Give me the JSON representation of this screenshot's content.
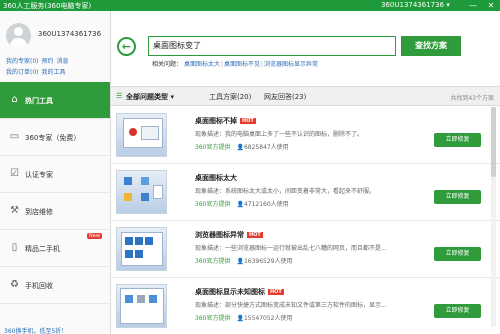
{
  "titlebar": {
    "app_title": "360人工服务(360电脑专家)",
    "user": "360U1374361736 ▾",
    "minimize": "—",
    "close": "✕"
  },
  "profile": {
    "username": "360U1374361736",
    "links_row1": [
      "我的专家(0)",
      "预约",
      "消息"
    ],
    "links_row2": [
      "我的订单(0)",
      "我的工具"
    ]
  },
  "sidebar": {
    "items": [
      {
        "label": "热门工具",
        "icon": "home-icon"
      },
      {
        "label": "360专家（免费）",
        "icon": "chat-icon"
      },
      {
        "label": "认证专家",
        "icon": "check-icon"
      },
      {
        "label": "到店维修",
        "icon": "wrench-icon"
      },
      {
        "label": "精品二手机",
        "icon": "phone-icon",
        "badge": "New"
      },
      {
        "label": "手机回收",
        "icon": "recycle-icon"
      }
    ],
    "promo": "360换手机，低至5折！"
  },
  "search": {
    "value": "桌面图标变了",
    "button": "查找方案",
    "related_label": "相关问题：",
    "related": [
      "桌面图标太大",
      "桌面图标不见",
      "浏览器图标显示异常"
    ]
  },
  "filters": {
    "all_types": "全部问题类型",
    "tools": "工具方案(20)",
    "netizen": "网友回答(23)",
    "count": "共找到43个方案"
  },
  "results": [
    {
      "title": "桌面图标不掉",
      "hot": "HOT",
      "desc": "现象描述：我的电脑桌面上多了一些不认识的图标，删除不了。",
      "provider": "360官方提供",
      "users": "6825847人使用",
      "button": "立即修复"
    },
    {
      "title": "桌面图标太大",
      "hot": "",
      "desc": "现象描述：系统图标太大或太小，间距变着非常大，看起来不舒服。",
      "provider": "360官方提供",
      "users": "4712160人使用",
      "button": "立即修复"
    },
    {
      "title": "浏览器图标异常",
      "hot": "HOT",
      "desc": "现象描述：一些浏览器图标一运行就被出乱七八糟的网页，而且都不是...",
      "provider": "360官方提供",
      "users": "16396529人使用",
      "button": "立即修复"
    },
    {
      "title": "桌面图标显示未知图标",
      "hot": "HOT",
      "desc": "现象描述：部分快捷方式图标变成未知文件或第三方软件的图标，显示...",
      "provider": "360官方提供",
      "users": "15547052人使用",
      "button": "立即修复"
    }
  ]
}
